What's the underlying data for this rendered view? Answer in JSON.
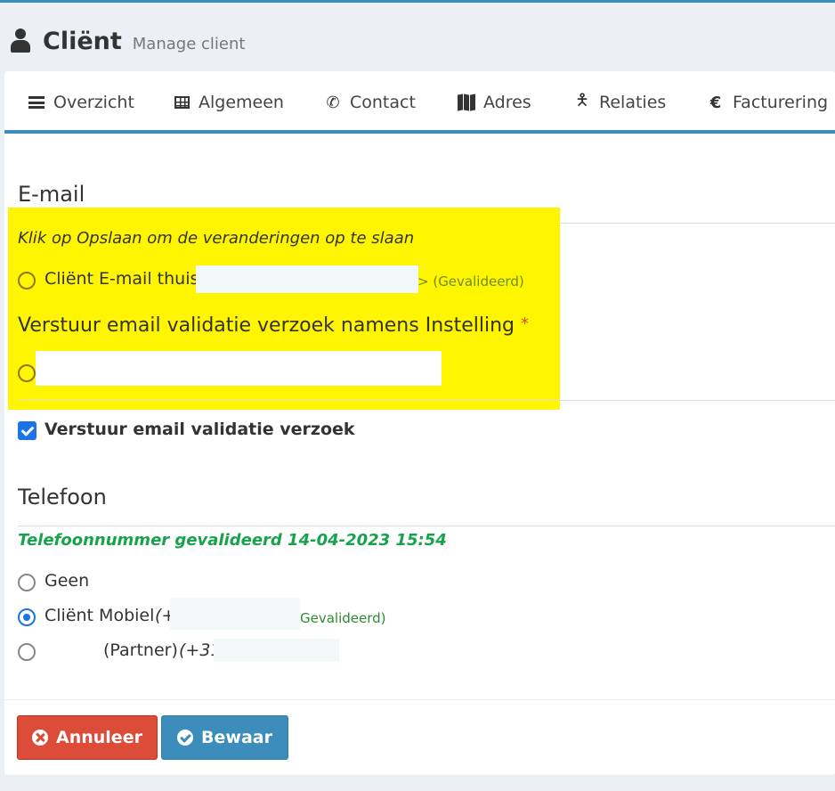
{
  "header": {
    "title": "Cliënt",
    "subtitle": "Manage client"
  },
  "tabs": [
    {
      "label": "Overzicht",
      "icon": "bars-icon"
    },
    {
      "label": "Algemeen",
      "icon": "table-icon"
    },
    {
      "label": "Contact",
      "icon": "phone-icon"
    },
    {
      "label": "Adres",
      "icon": "map-icon"
    },
    {
      "label": "Relaties",
      "icon": "person-icon"
    },
    {
      "label": "Facturering",
      "icon": "euro-icon"
    }
  ],
  "email": {
    "section_title": "E-mail",
    "notice": "Klik op Opslaan om de veranderingen op te slaan",
    "option_label": "Cliënt E-mail thuis",
    "option_status": "> (Gevalideerd)",
    "send_on_behalf_label": "Verstuur email validatie verzoek namens Instelling",
    "required_mark": "*",
    "send_checkbox_label": "Verstuur email validatie verzoek",
    "send_checkbox_checked": true
  },
  "phone": {
    "section_title": "Telefoon",
    "validated_notice": "Telefoonnummer gevalideerd 14-04-2023 15:54",
    "options": [
      {
        "label": "Geen",
        "checked": false
      },
      {
        "label": "Cliënt Mobiel",
        "number_prefix": "(+",
        "status": "Gevalideerd)",
        "checked": true
      },
      {
        "label": "(Partner)",
        "number_prefix": "(+31",
        "checked": false
      }
    ]
  },
  "buttons": {
    "cancel": "Annuleer",
    "save": "Bewaar"
  },
  "colors": {
    "primary": "#3c8dbc",
    "danger": "#dd4b39",
    "highlight": "#fff500",
    "validated_green": "#16a34a"
  }
}
